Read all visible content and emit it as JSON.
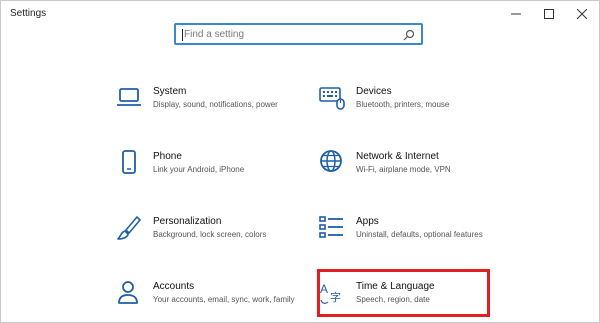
{
  "window": {
    "title": "Settings",
    "controls": {
      "minimize": "minimize",
      "maximize": "maximize",
      "close": "close"
    }
  },
  "search": {
    "placeholder": "Find a setting",
    "value": "",
    "icon": "search-icon"
  },
  "tiles": [
    {
      "title": "System",
      "description": "Display, sound, notifications, power",
      "icon": "laptop-icon"
    },
    {
      "title": "Devices",
      "description": "Bluetooth, printers, mouse",
      "icon": "keyboard-icon"
    },
    {
      "title": "Phone",
      "description": "Link your Android, iPhone",
      "icon": "phone-icon"
    },
    {
      "title": "Network & Internet",
      "description": "Wi-Fi, airplane mode, VPN",
      "icon": "globe-icon"
    },
    {
      "title": "Personalization",
      "description": "Background, lock screen, colors",
      "icon": "paintbrush-icon"
    },
    {
      "title": "Apps",
      "description": "Uninstall, defaults, optional features",
      "icon": "apps-list-icon"
    },
    {
      "title": "Accounts",
      "description": "Your accounts, email, sync, work, family",
      "icon": "person-icon"
    },
    {
      "title": "Time & Language",
      "description": "Speech, region, date",
      "icon": "time-language-icon"
    }
  ],
  "colors": {
    "icon": "#1f5fa8",
    "search_border": "#3a87c9",
    "highlight": "#e02020"
  }
}
